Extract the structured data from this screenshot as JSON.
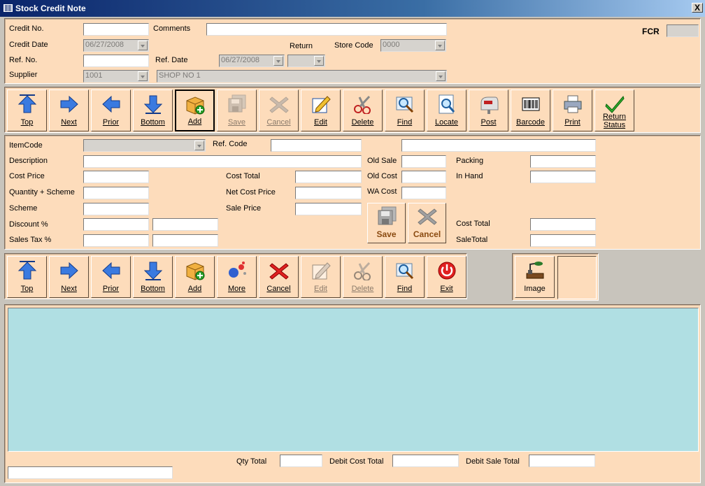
{
  "window": {
    "title": "Stock Credit Note",
    "close": "X"
  },
  "header": {
    "credit_no_label": "Credit No.",
    "comments_label": "Comments",
    "fcr_label": "FCR",
    "credit_date_label": "Credit Date",
    "credit_date_value": "06/27/2008",
    "return_label": "Return",
    "store_code_label": "Store Code",
    "store_code_value": "0000",
    "ref_no_label": "Ref. No.",
    "ref_date_label": "Ref. Date",
    "ref_date_value": "06/27/2008",
    "supplier_label": "Supplier",
    "supplier_code": "1001",
    "supplier_name": "SHOP NO 1"
  },
  "toolbar1": [
    {
      "label": "Top",
      "icon": "arrow-up-icon"
    },
    {
      "label": "Next",
      "icon": "arrow-right-icon"
    },
    {
      "label": "Prior",
      "icon": "arrow-left-icon"
    },
    {
      "label": "Bottom",
      "icon": "arrow-down-icon"
    },
    {
      "label": "Add",
      "icon": "box-add-icon"
    },
    {
      "label": "Save",
      "icon": "floppy-icon"
    },
    {
      "label": "Cancel",
      "icon": "x-icon"
    },
    {
      "label": "Edit",
      "icon": "pencil-icon"
    },
    {
      "label": "Delete",
      "icon": "scissors-icon"
    },
    {
      "label": "Find",
      "icon": "magnifier-icon"
    },
    {
      "label": "Locate",
      "icon": "locate-icon"
    },
    {
      "label": "Post",
      "icon": "mailbox-icon"
    },
    {
      "label": "Barcode",
      "icon": "barcode-icon"
    },
    {
      "label": "Print",
      "icon": "printer-icon"
    },
    {
      "label1": "Return",
      "label2": "Status",
      "icon": "checkmark-icon"
    }
  ],
  "item": {
    "itemcode_label": "ItemCode",
    "refcode_label": "Ref. Code",
    "description_label": "Description",
    "old_sale_label": "Old Sale",
    "packing_label": "Packing",
    "cost_price_label": "Cost Price",
    "cost_total_label": "Cost Total",
    "old_cost_label": "Old Cost",
    "in_hand_label": "In Hand",
    "qty_scheme_label": "Quantity + Scheme",
    "net_cost_label": "Net Cost Price",
    "wa_cost_label": "WA Cost",
    "scheme_label": "Scheme",
    "sale_price_label": "Sale Price",
    "discount_label": "Discount %",
    "cost_total2_label": "Cost Total",
    "sales_tax_label": "Sales Tax %",
    "sale_total_label": "SaleTotal",
    "save_label": "Save",
    "cancel_label": "Cancel"
  },
  "toolbar2": [
    {
      "label": "Top",
      "icon": "arrow-up-icon"
    },
    {
      "label": "Next",
      "icon": "arrow-right-icon"
    },
    {
      "label": "Prior",
      "icon": "arrow-left-icon"
    },
    {
      "label": "Bottom",
      "icon": "arrow-down-icon"
    },
    {
      "label": "Add",
      "icon": "box-add-icon"
    },
    {
      "label": "More",
      "icon": "molecule-icon"
    },
    {
      "label": "Cancel",
      "icon": "x-icon"
    },
    {
      "label": "Edit",
      "icon": "pencil-icon"
    },
    {
      "label": "Delete",
      "icon": "scissors-icon"
    },
    {
      "label": "Find",
      "icon": "magnifier-icon"
    },
    {
      "label": "Exit",
      "icon": "power-icon"
    }
  ],
  "image_label": "Image",
  "footer": {
    "qty_total_label": "Qty Total",
    "debit_cost_label": "Debit Cost Total",
    "debit_sale_label": "Debit Sale Total"
  },
  "colors": {
    "panel": "#fddcbb",
    "grid": "#b0dfe3",
    "title_start": "#0a246a"
  }
}
